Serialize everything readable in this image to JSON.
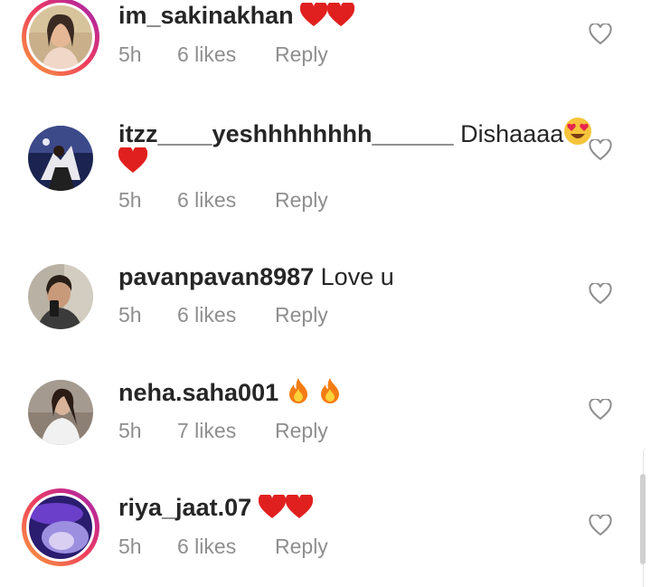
{
  "comments": [
    {
      "username": "im_sakinakhan",
      "text": "",
      "emoji": [
        "red-heart",
        "red-heart"
      ],
      "time": "5h",
      "likes": "6 likes",
      "reply": "Reply",
      "story_ring": true
    },
    {
      "username": "itzz____yeshhhhhhhh______",
      "text": "Dishaaaa",
      "emoji": [
        "heart-eyes",
        "red-heart"
      ],
      "time": "5h",
      "likes": "6 likes",
      "reply": "Reply",
      "story_ring": false
    },
    {
      "username": "pavanpavan8987",
      "text": "Love u",
      "emoji": [],
      "time": "5h",
      "likes": "6 likes",
      "reply": "Reply",
      "story_ring": false
    },
    {
      "username": "neha.saha001",
      "text": "",
      "emoji": [
        "fire",
        "fire"
      ],
      "time": "5h",
      "likes": "7 likes",
      "reply": "Reply",
      "story_ring": false
    },
    {
      "username": "riya_jaat.07",
      "text": "",
      "emoji": [
        "red-heart",
        "red-heart"
      ],
      "time": "5h",
      "likes": "6 likes",
      "reply": "Reply",
      "story_ring": true
    }
  ],
  "colors": {
    "username": "#262626",
    "meta": "#8e8e8e",
    "heart_emoji": "#e0201f",
    "story_ring_start": "#f9a13a",
    "story_ring_end": "#8a3ab9"
  }
}
